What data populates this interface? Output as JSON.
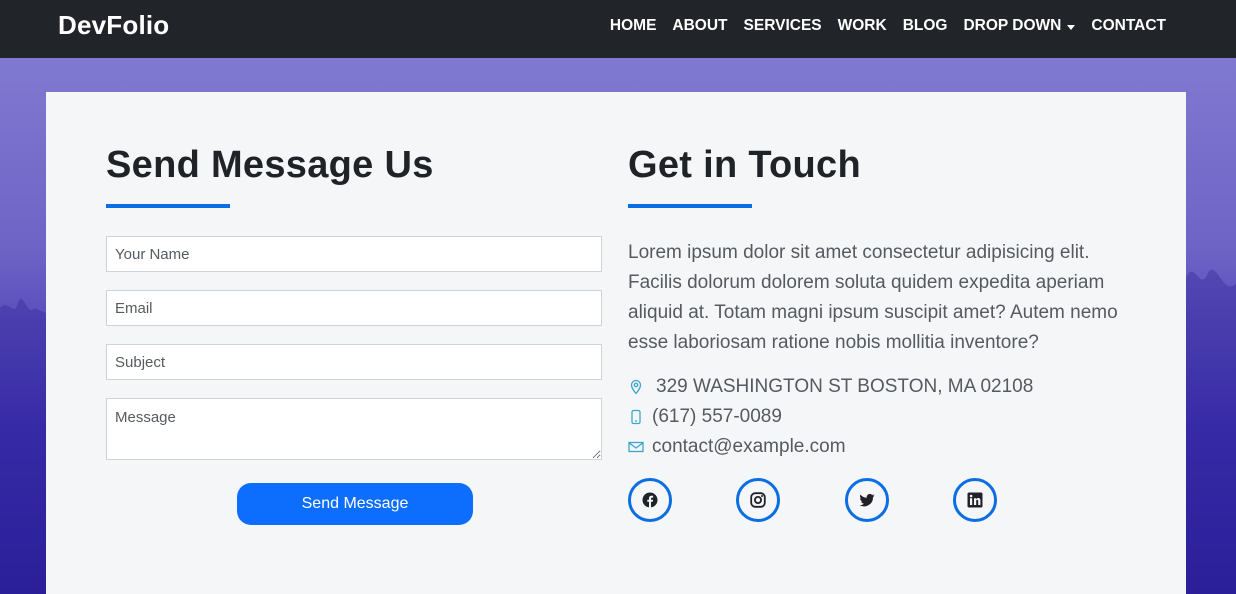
{
  "nav": {
    "brand": "DevFolio",
    "items": [
      {
        "label": "HOME"
      },
      {
        "label": "ABOUT"
      },
      {
        "label": "SERVICES"
      },
      {
        "label": "WORK"
      },
      {
        "label": "BLOG"
      },
      {
        "label": "DROP DOWN",
        "has_caret": true
      },
      {
        "label": "CONTACT"
      }
    ]
  },
  "form": {
    "title": "Send Message Us",
    "name_placeholder": "Your Name",
    "email_placeholder": "Email",
    "subject_placeholder": "Subject",
    "message_placeholder": "Message",
    "submit_label": "Send Message"
  },
  "contact": {
    "title": "Get in Touch",
    "description": "Lorem ipsum dolor sit amet consectetur adipisicing elit. Facilis dolorum dolorem soluta quidem expedita aperiam aliquid at. Totam magni ipsum suscipit amet? Autem nemo esse laboriosam ratione nobis mollitia inventore?",
    "address": "329 WASHINGTON ST BOSTON, MA 02108",
    "phone": "(617) 557-0089",
    "email": "contact@example.com",
    "social": [
      "facebook-icon",
      "instagram-icon",
      "twitter-icon",
      "linkedin-icon"
    ]
  },
  "colors": {
    "accent": "#0b6fe3",
    "button": "#0d6efd",
    "navbar": "#212529",
    "card": "#f5f6f8",
    "icon_teal": "#3aa6c9"
  }
}
